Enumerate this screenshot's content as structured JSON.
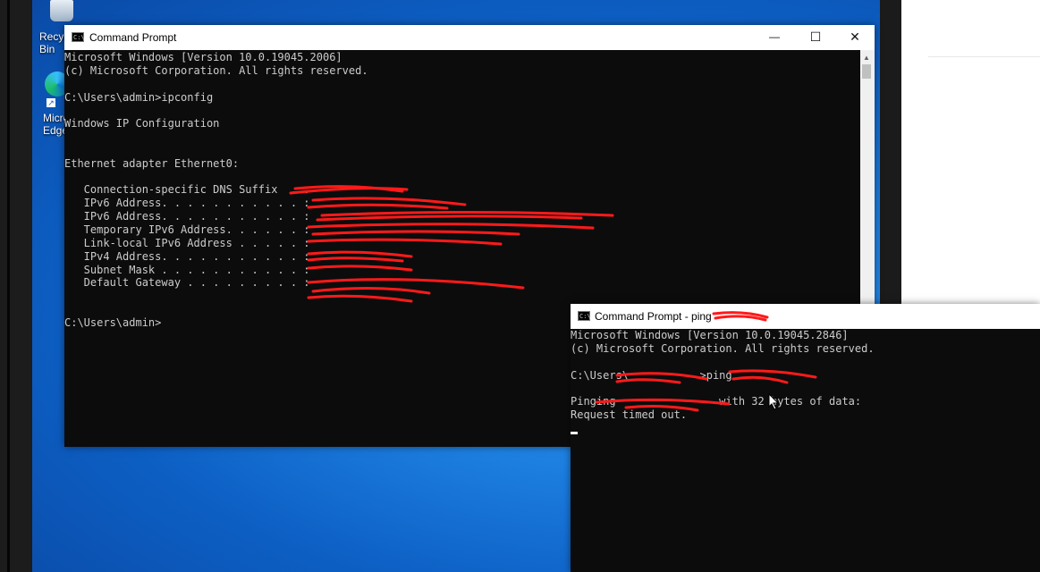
{
  "desktop": {
    "icons": [
      {
        "label": "Recycle Bin",
        "icon": "recycle-bin-icon"
      },
      {
        "label": "Microsoft Edge",
        "icon": "edge-icon"
      }
    ]
  },
  "window1": {
    "title": "Command Prompt",
    "controls": {
      "minimize": "—",
      "maximize": "☐",
      "close": "✕"
    },
    "lines": [
      "Microsoft Windows [Version 10.0.19045.2006]",
      "(c) Microsoft Corporation. All rights reserved.",
      "",
      "C:\\Users\\admin>ipconfig",
      "",
      "Windows IP Configuration",
      "",
      "",
      "Ethernet adapter Ethernet0:",
      "",
      "   Connection-specific DNS Suffix  . :",
      "   IPv6 Address. . . . . . . . . . . :",
      "   IPv6 Address. . . . . . . . . . . :",
      "   Temporary IPv6 Address. . . . . . :",
      "   Link-local IPv6 Address . . . . . :",
      "   IPv4 Address. . . . . . . . . . . :",
      "   Subnet Mask . . . . . . . . . . . :",
      "   Default Gateway . . . . . . . . . :",
      "",
      "",
      "C:\\Users\\admin>"
    ]
  },
  "window2": {
    "title": "Command Prompt - ping",
    "lines": [
      "Microsoft Windows [Version 10.0.19045.2846]",
      "(c) Microsoft Corporation. All rights reserved.",
      "",
      "C:\\Users\\",
      "",
      "Pinging",
      "Request timed out."
    ],
    "prompt_suffix": ">ping",
    "ping_suffix": "with 32 bytes of data:"
  },
  "colors": {
    "console_bg": "#0c0c0c",
    "console_text": "#cccccc",
    "redaction": "#ff1a1a"
  }
}
